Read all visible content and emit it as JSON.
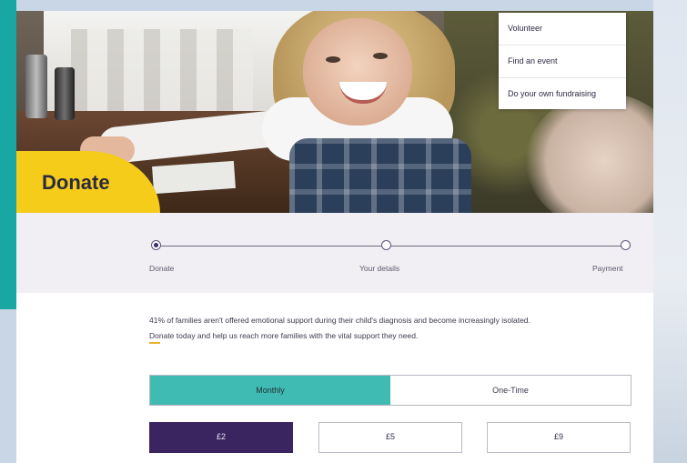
{
  "nav": {
    "dropdown_items": [
      "Volunteer",
      "Find an event",
      "Do your own fundraising"
    ]
  },
  "hero": {
    "badge": "Donate"
  },
  "stepper": {
    "steps": [
      {
        "label": "Donate",
        "active": true
      },
      {
        "label": "Your details",
        "active": false
      },
      {
        "label": "Payment",
        "active": false
      }
    ]
  },
  "intro": {
    "text": "41% of families aren't offered emotional support during their child's diagnosis and become increasingly isolated. Donate today and help us reach more families with the vital support they need."
  },
  "frequency": {
    "options": [
      "Monthly",
      "One-Time"
    ],
    "selected": "Monthly"
  },
  "amounts": {
    "options": [
      "£2",
      "£5",
      "£9"
    ],
    "selected": "£2"
  },
  "colors": {
    "teal": "#40bbb4",
    "yellow": "#f5cc1a",
    "purple": "#3a2560"
  }
}
